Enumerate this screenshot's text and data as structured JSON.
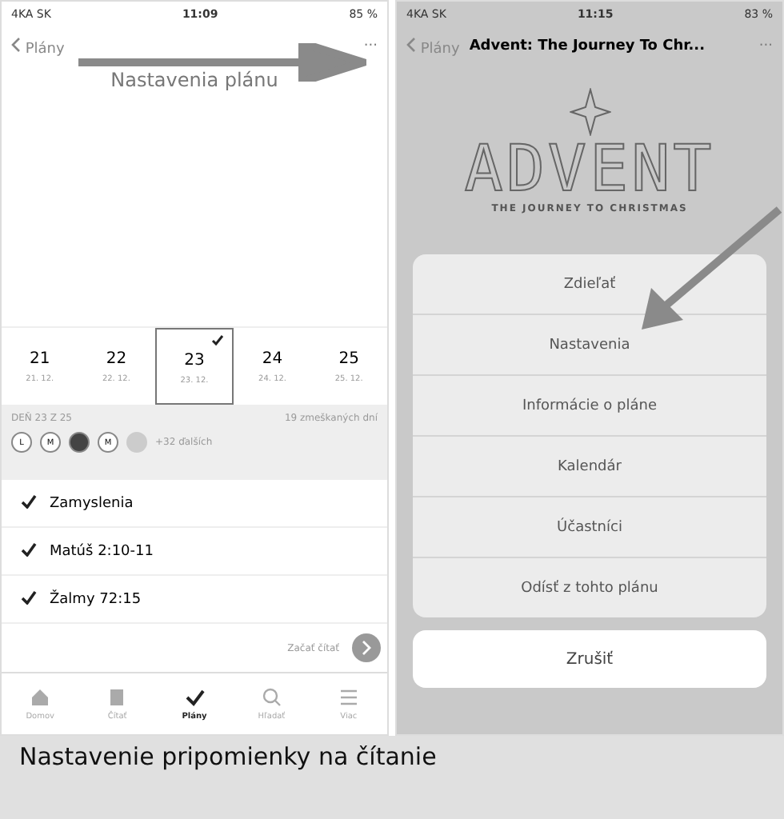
{
  "left_phone": {
    "status_bar": {
      "carrier": "4KA SK",
      "time": "11:09",
      "battery": "85 %"
    },
    "nav": {
      "back": "Plány",
      "more": "···"
    },
    "annotation": "Nastavenia plánu",
    "days": [
      {
        "day": "21",
        "date": "21. 12.",
        "selected": false,
        "done": false
      },
      {
        "day": "22",
        "date": "22. 12.",
        "selected": false,
        "done": false
      },
      {
        "day": "23",
        "date": "23. 12.",
        "selected": true,
        "done": true
      },
      {
        "day": "24",
        "date": "24. 12.",
        "selected": false,
        "done": false
      },
      {
        "day": "25",
        "date": "25. 12.",
        "selected": false,
        "done": false
      }
    ],
    "progress": {
      "day_label": "DEŇ 23 Z 25",
      "missed": "19 zmeškaných dní"
    },
    "participants": [
      {
        "kind": "letter",
        "label": "L"
      },
      {
        "kind": "letter",
        "label": "M"
      },
      {
        "kind": "photo"
      },
      {
        "kind": "letter",
        "label": "M"
      },
      {
        "kind": "lamp"
      }
    ],
    "more_participants": "+32 ďalších",
    "readings": [
      {
        "label": "Zamyslenia",
        "checked": true
      },
      {
        "label": "Matúš 2:10-11",
        "checked": true
      },
      {
        "label": "Žalmy 72:15",
        "checked": true
      }
    ],
    "start_reading": "Začať čítať",
    "tabs": [
      {
        "label": "Domov",
        "selected": false
      },
      {
        "label": "Čítať",
        "selected": false
      },
      {
        "label": "Plány",
        "selected": true
      },
      {
        "label": "Hľadať",
        "selected": false
      },
      {
        "label": "Viac",
        "selected": false
      }
    ]
  },
  "right_phone": {
    "status_bar": {
      "carrier": "4KA SK",
      "time": "11:15",
      "battery": "83 %"
    },
    "nav": {
      "back": "Plány",
      "title": "Advent: The Journey To Chr...",
      "more": "···"
    },
    "artwork": {
      "title": "ADVENT",
      "subtitle": "THE JOURNEY TO CHRISTMAS"
    },
    "action_sheet": [
      "Zdieľať",
      "Nastavenia",
      "Informácie o pláne",
      "Kalendár",
      "Účastníci",
      "Odísť z tohto plánu"
    ],
    "cancel": "Zrušiť"
  },
  "caption": "Nastavenie pripomienky na čítanie"
}
